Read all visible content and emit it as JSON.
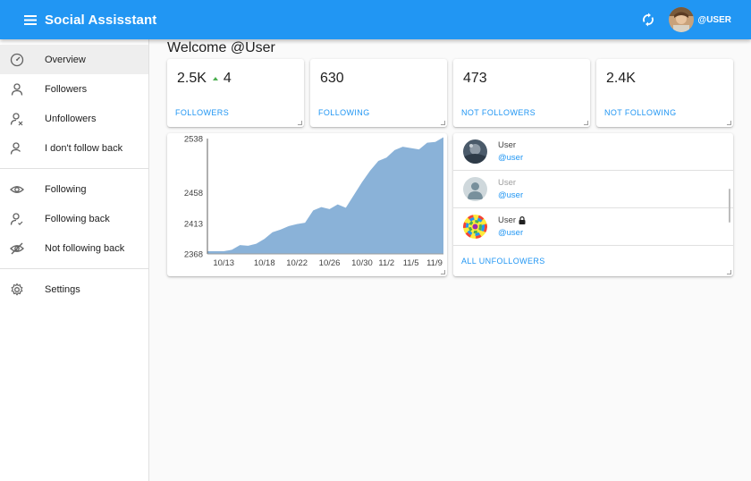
{
  "app": {
    "title": "Social Assisstant",
    "user_label": "@USER",
    "accent": "#2196f3"
  },
  "sidebar": {
    "items": [
      {
        "label": "Overview",
        "icon": "gauge-icon",
        "active": true
      },
      {
        "label": "Followers",
        "icon": "person-icon"
      },
      {
        "label": "Unfollowers",
        "icon": "person-remove-icon"
      },
      {
        "label": "I don't follow back",
        "icon": "person-outline-icon"
      },
      {
        "label": "Following",
        "icon": "eye-icon"
      },
      {
        "label": "Following back",
        "icon": "person-check-icon"
      },
      {
        "label": "Not following back",
        "icon": "eye-off-icon"
      },
      {
        "label": "Settings",
        "icon": "gear-icon"
      }
    ]
  },
  "main": {
    "welcome": "Welcome @User",
    "stats": [
      {
        "value": "2.5K",
        "delta": "4",
        "link": "FOLLOWERS"
      },
      {
        "value": "630",
        "link": "FOLLOWING"
      },
      {
        "value": "473",
        "link": "NOT FOLLOWERS"
      },
      {
        "value": "2.4K",
        "link": "NOT FOLLOWING"
      }
    ],
    "unfollowers": {
      "rows": [
        {
          "name": "User",
          "handle": "@user",
          "avatar": "photo",
          "muted": false,
          "locked": false
        },
        {
          "name": "User",
          "handle": "@user",
          "avatar": "default",
          "muted": true,
          "locked": false
        },
        {
          "name": "User",
          "handle": "@user",
          "avatar": "rainbow",
          "muted": false,
          "locked": true
        }
      ],
      "all_link": "ALL UNFOLLOWERS"
    }
  },
  "chart_data": {
    "type": "area",
    "title": "",
    "xlabel": "",
    "ylabel": "",
    "ylim": [
      2368,
      2538
    ],
    "yticks": [
      2368,
      2413,
      2458,
      2538
    ],
    "xticks": [
      "10/13",
      "10/18",
      "10/22",
      "10/26",
      "10/30",
      "11/2",
      "11/5",
      "11/9"
    ],
    "color": "#8ab2d8",
    "x": [
      "10/11",
      "10/12",
      "10/13",
      "10/14",
      "10/15",
      "10/16",
      "10/17",
      "10/18",
      "10/19",
      "10/20",
      "10/21",
      "10/22",
      "10/23",
      "10/24",
      "10/25",
      "10/26",
      "10/27",
      "10/28",
      "10/29",
      "10/30",
      "10/31",
      "11/1",
      "11/2",
      "11/3",
      "11/4",
      "11/5",
      "11/6",
      "11/7",
      "11/8",
      "11/9"
    ],
    "values": [
      2372,
      2372,
      2372,
      2374,
      2381,
      2380,
      2383,
      2390,
      2400,
      2404,
      2409,
      2412,
      2414,
      2432,
      2437,
      2434,
      2441,
      2436,
      2455,
      2474,
      2491,
      2505,
      2510,
      2521,
      2526,
      2524,
      2522,
      2532,
      2533,
      2540
    ]
  }
}
